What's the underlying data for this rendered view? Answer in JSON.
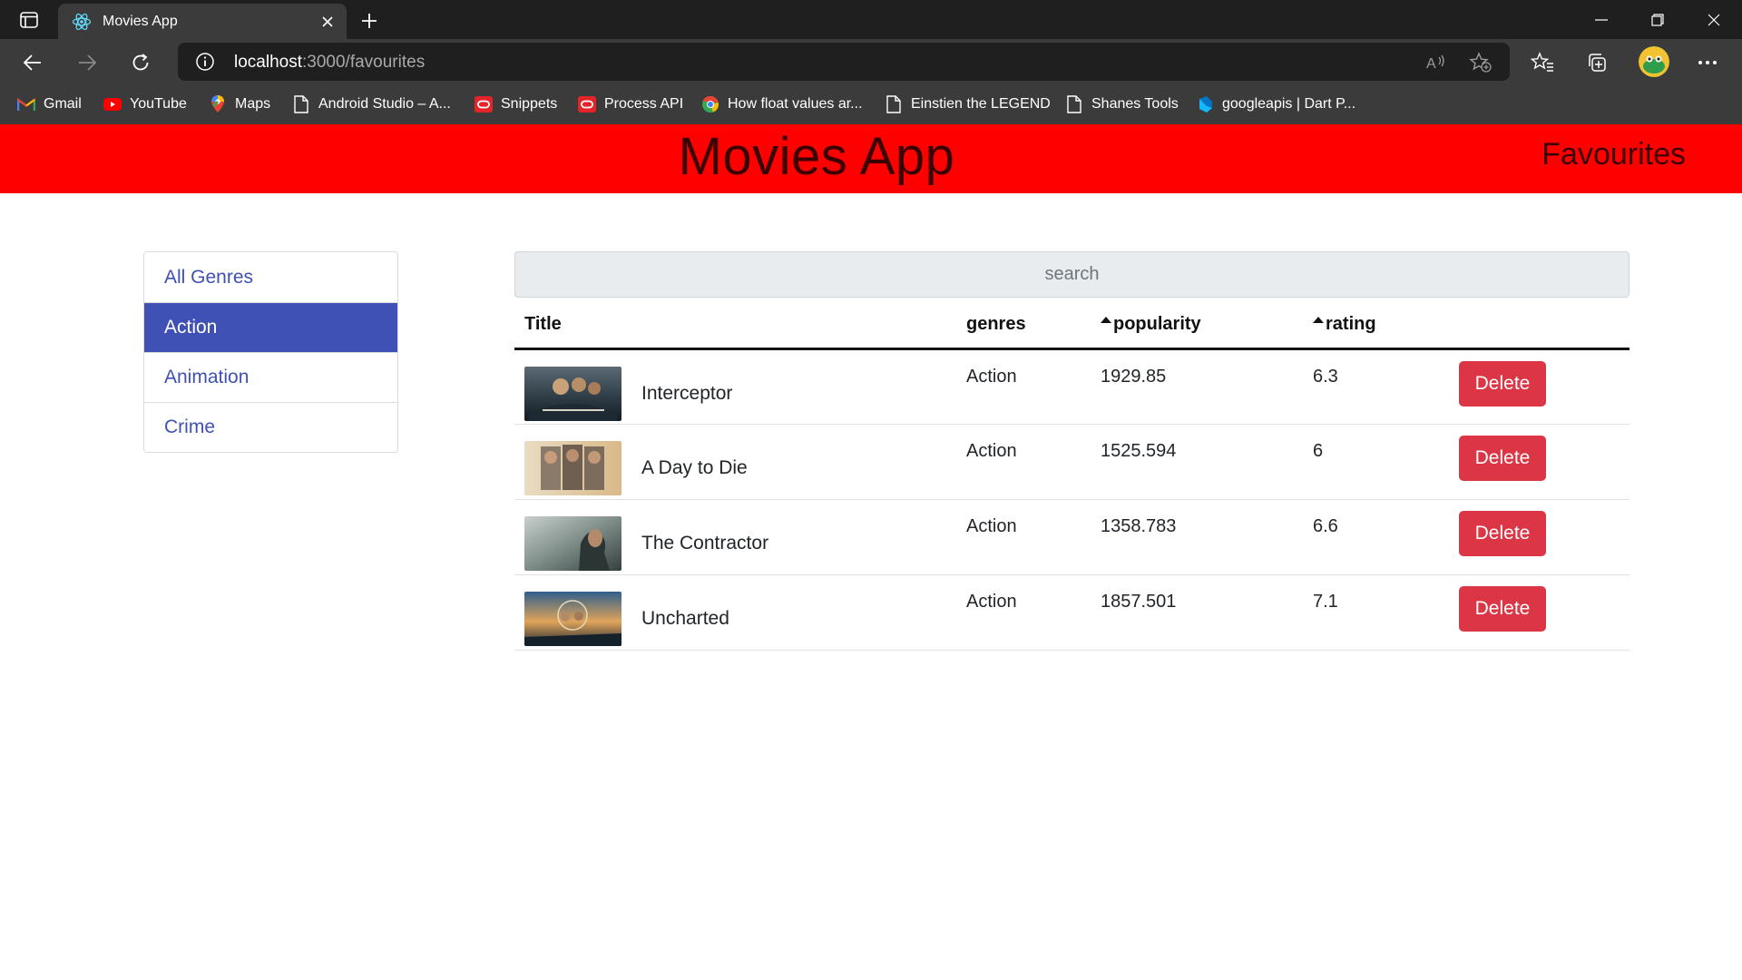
{
  "browser": {
    "tab_title": "Movies App",
    "url_host": "localhost",
    "url_rest": ":3000/favourites",
    "bookmarks": [
      {
        "label": "Gmail",
        "icon": "gmail-icon"
      },
      {
        "label": "YouTube",
        "icon": "youtube-icon"
      },
      {
        "label": "Maps",
        "icon": "maps-icon"
      },
      {
        "label": "Android Studio – A...",
        "icon": "page-icon"
      },
      {
        "label": "Snippets",
        "icon": "oracle-icon"
      },
      {
        "label": "Process API",
        "icon": "oracle-icon"
      },
      {
        "label": "How float values ar...",
        "icon": "chrome-icon"
      },
      {
        "label": "Einstien the LEGEND",
        "icon": "page-icon"
      },
      {
        "label": "Shanes Tools",
        "icon": "page-icon"
      },
      {
        "label": "googleapis | Dart P...",
        "icon": "dart-icon"
      }
    ]
  },
  "app": {
    "title": "Movies App",
    "favourites_link": "Favourites",
    "search_placeholder": "search",
    "genres": [
      "All Genres",
      "Action",
      "Animation",
      "Crime"
    ],
    "active_genre": "Action",
    "columns": {
      "title": "Title",
      "genres": "genres",
      "popularity": "popularity",
      "rating": "rating"
    },
    "movies": [
      {
        "title": "Interceptor",
        "genre": "Action",
        "popularity": "1929.85",
        "rating": "6.3",
        "delete": "Delete"
      },
      {
        "title": "A Day to Die",
        "genre": "Action",
        "popularity": "1525.594",
        "rating": "6",
        "delete": "Delete"
      },
      {
        "title": "The Contractor",
        "genre": "Action",
        "popularity": "1358.783",
        "rating": "6.6",
        "delete": "Delete"
      },
      {
        "title": "Uncharted",
        "genre": "Action",
        "popularity": "1857.501",
        "rating": "7.1",
        "delete": "Delete"
      }
    ]
  },
  "colors": {
    "header_bg": "#ff0000",
    "active_genre_bg": "#3f51b5",
    "delete_bg": "#dc3545"
  }
}
